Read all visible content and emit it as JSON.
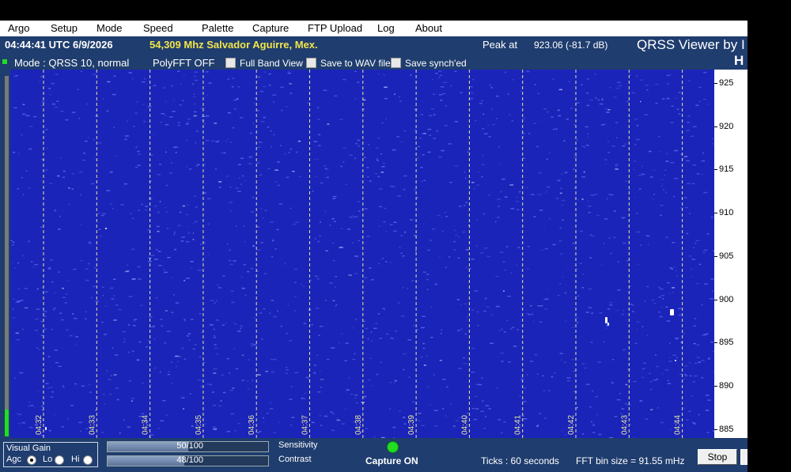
{
  "menu": [
    "Argo",
    "Setup",
    "Mode",
    "Speed",
    "Palette",
    "Capture",
    "FTP Upload",
    "Log",
    "About"
  ],
  "info": {
    "utc": "04:44:41 UTC  6/9/2026",
    "station": "54,309 Mhz Salvador Aguirre, Mex.",
    "peak_label": "Peak at",
    "peak_value": "923.06 (-81.7 dB)",
    "viewer_title": "QRSS Viewer by I",
    "viewer_subtitle": "H"
  },
  "mode": {
    "mode_text": "Mode : QRSS 10, normal",
    "polyfft": "PolyFFT OFF",
    "checkboxes": [
      "Full Band View",
      "Save to WAV file",
      "Save synch'ed"
    ]
  },
  "spectrogram": {
    "time_ticks": [
      "04:32",
      "04:33",
      "04:34",
      "04:35",
      "04:36",
      "04:37",
      "04:38",
      "04:39",
      "04:40",
      "04:41",
      "04:42",
      "04:43",
      "04:44"
    ],
    "freq_ticks": [
      "925",
      "920",
      "915",
      "910",
      "905",
      "900",
      "895",
      "890",
      "885"
    ],
    "colors": {
      "background": "#1a24b8",
      "speckle": "#5a6cf0",
      "bright": "#ffffff",
      "time_marker": "#e8e6a0"
    }
  },
  "bottom": {
    "gain_title": "Visual Gain",
    "agc_label": "Agc",
    "lo_label": "Lo",
    "hi_label": "Hi",
    "sensitivity_value": "50/100",
    "sensitivity_level": 0.5,
    "sensitivity_label": "Sensitivity",
    "contrast_value": "48/100",
    "contrast_level": 0.48,
    "contrast_label": "Contrast",
    "capture_status": "Capture ON",
    "ticks": "Ticks  :  60 seconds",
    "bin_size": "FFT bin size = 91.55 mHz",
    "stop_label": "Stop"
  }
}
